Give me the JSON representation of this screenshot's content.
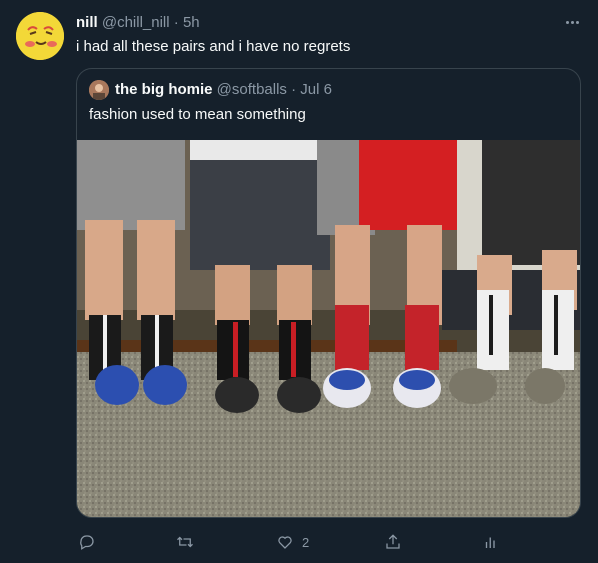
{
  "tweet": {
    "author_name": "nill",
    "author_handle": "@chill_nill",
    "separator": "·",
    "time": "5h",
    "text": "i had all these pairs and i have no regrets"
  },
  "quote": {
    "author_name": "the big homie",
    "author_handle": "@softballs",
    "separator": "·",
    "time": "Jul 6",
    "text": "fashion used to mean something"
  },
  "actions": {
    "reply_icon": "reply-icon",
    "retweet_icon": "retweet-icon",
    "like_icon": "heart-icon",
    "like_count": "2",
    "share_icon": "share-icon",
    "analytics_icon": "analytics-icon"
  },
  "colors": {
    "background": "#15202b",
    "border": "#38444d",
    "muted": "#8b98a5",
    "text": "#f7f9f9"
  }
}
